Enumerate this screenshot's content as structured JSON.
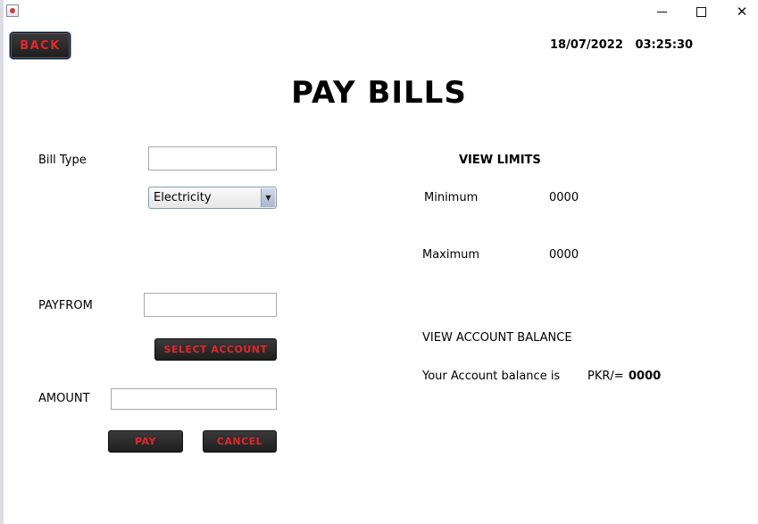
{
  "window": {
    "icon": "java-app-icon",
    "controls": [
      "minimize-icon",
      "maximize-icon",
      "close-icon"
    ]
  },
  "header": {
    "back_label": "BACK",
    "date": "18/07/2022",
    "time": "03:25:30",
    "title": "PAY BILLS"
  },
  "form": {
    "bill_type_label": "Bill Type",
    "bill_type_value": "",
    "bill_type_selected": "Electricity",
    "payfrom_label": "PAYFROM",
    "payfrom_value": "",
    "select_account_label": "SELECT ACCOUNT",
    "amount_label": "AMOUNT",
    "amount_value": "",
    "pay_label": "PAY",
    "cancel_label": "CANCEL"
  },
  "limits": {
    "heading": "VIEW LIMITS",
    "minimum_label": "Minimum",
    "minimum_value": "0000",
    "maximum_label": "Maximum",
    "maximum_value": "0000"
  },
  "balance": {
    "heading": "VIEW ACCOUNT BALANCE",
    "text": "Your Account balance is",
    "currency": "PKR/=",
    "value": "0000"
  },
  "colors": {
    "button_bg": "#262626",
    "button_text": "#e3262b",
    "focus_ring": "#7aa2d6"
  }
}
